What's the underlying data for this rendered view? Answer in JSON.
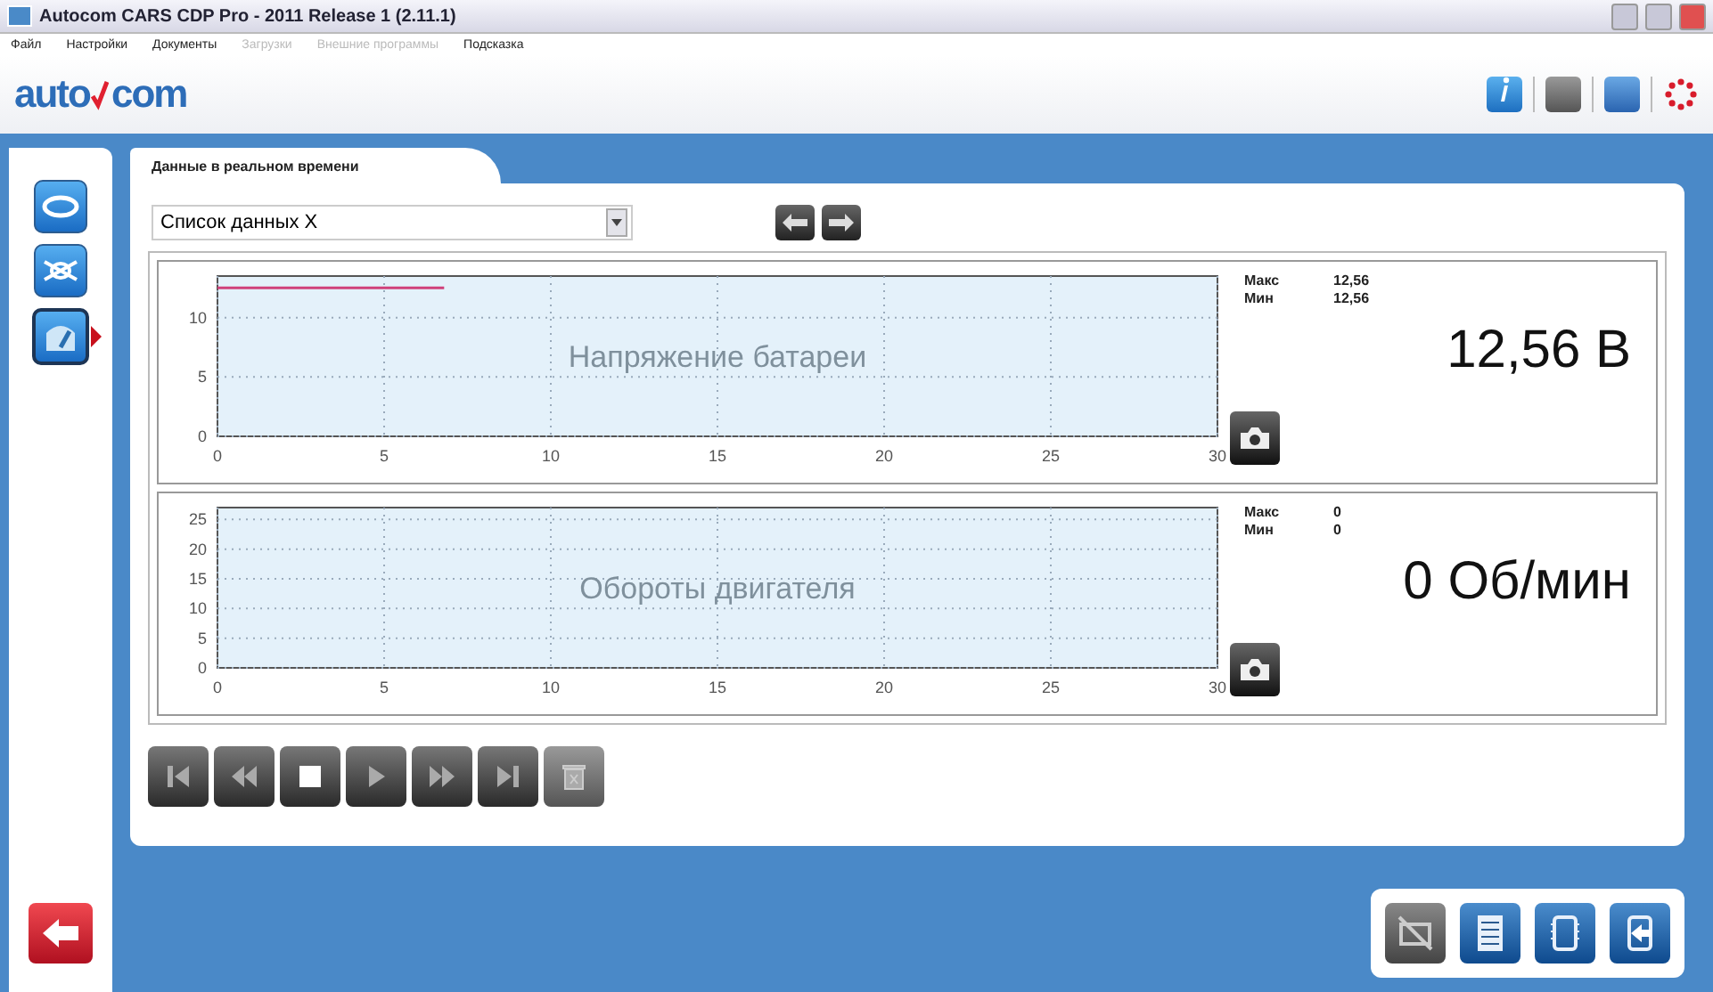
{
  "window": {
    "title": "Autocom CARS CDP Pro - 2011 Release 1 (2.11.1)"
  },
  "menu": [
    {
      "label": "Файл",
      "disabled": false
    },
    {
      "label": "Настройки",
      "disabled": false
    },
    {
      "label": "Документы",
      "disabled": false
    },
    {
      "label": "Загрузки",
      "disabled": true
    },
    {
      "label": "Внешние программы",
      "disabled": true
    },
    {
      "label": "Подсказка",
      "disabled": false
    }
  ],
  "logo": {
    "left": "auto",
    "right": "com"
  },
  "sidebar": {
    "items": [
      {
        "kind": "car",
        "selected": false
      },
      {
        "kind": "engine",
        "selected": false
      },
      {
        "kind": "gauge",
        "selected": true
      }
    ]
  },
  "tab": {
    "label": "Данные в реальном времени"
  },
  "data_list": {
    "value": "Список данных X"
  },
  "panels": [
    {
      "max_label": "Макс",
      "max": "12,56",
      "min_label": "Мин",
      "min": "12,56",
      "reading": "12,56 В",
      "chart_data": {
        "type": "line",
        "title": "Напряжение батареи",
        "x": [
          0,
          6.8
        ],
        "series": [
          {
            "color": "#d0407a",
            "values": [
              12.5,
              12.5
            ]
          }
        ],
        "grid": true,
        "xlim": [
          0,
          30
        ],
        "ylim": [
          0,
          13.5
        ],
        "xticks": [
          0,
          5,
          10,
          15,
          20,
          25,
          30
        ],
        "yticks": [
          0,
          5,
          10
        ]
      }
    },
    {
      "max_label": "Макс",
      "max": "0",
      "min_label": "Мин",
      "min": "0",
      "reading": "0 Об/мин",
      "chart_data": {
        "type": "line",
        "title": "Обороты двигателя",
        "grid": true,
        "xlim": [
          0,
          30
        ],
        "ylim": [
          0,
          27
        ],
        "xticks": [
          0,
          5,
          10,
          15,
          20,
          25,
          30
        ],
        "yticks": [
          0,
          5,
          10,
          15,
          20,
          25
        ]
      }
    }
  ]
}
